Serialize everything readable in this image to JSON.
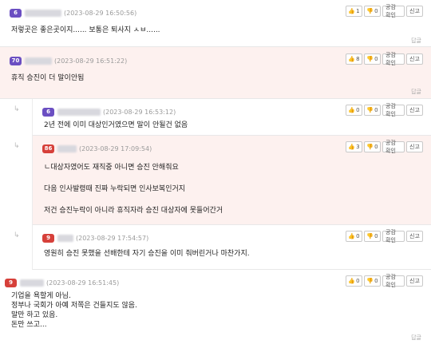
{
  "buttons": {
    "sympathy": "공감 확인",
    "report": "신고",
    "reply": "답글",
    "reply_arrow": "↳"
  },
  "comments": [
    {
      "level": "6",
      "date": "(2023-08-29 16:50:56)",
      "up": "1",
      "down": "0",
      "lines": [
        "저렇곳은 좋은곳이지...... 보통은 퇴사지 ㅅㅂ......"
      ]
    },
    {
      "level": "70",
      "date": "(2023-08-29 16:51:22)",
      "up": "8",
      "down": "0",
      "lines": [
        "휴직 승진이 더 말이안됨"
      ]
    },
    {
      "level": "6",
      "date": "(2023-08-29 16:53:12)",
      "up": "0",
      "down": "0",
      "lines": [
        "2년 전에 이미 대상인거였으면 말이 안될건 없음"
      ]
    },
    {
      "level": "86",
      "date": "(2023-08-29 17:09:54)",
      "up": "3",
      "down": "0",
      "lines": [
        "ㄴ대상자였어도 재직중 아니면 승진 안해줘요",
        "다음 인사발령때 진짜 누락되면 인사보복인거지",
        "저건 승진누락이 아니라 휴직자라 승진 대상자에 못들어간거"
      ]
    },
    {
      "level": "9",
      "date": "(2023-08-29 17:54:57)",
      "up": "0",
      "down": "0",
      "lines": [
        "영원히 승진 못했을 선배한테 자기 승진을 이미 줘버린거나 마찬가지."
      ]
    },
    {
      "level": "9",
      "date": "(2023-08-29 16:51:45)",
      "up": "0",
      "down": "0",
      "lines": [
        "기업을 욕할게 아님.",
        "정부나 국회가 아예 저쪽은 건들지도 않음.",
        "말만 하고 있음.",
        "돈만 쓰고..."
      ]
    }
  ]
}
